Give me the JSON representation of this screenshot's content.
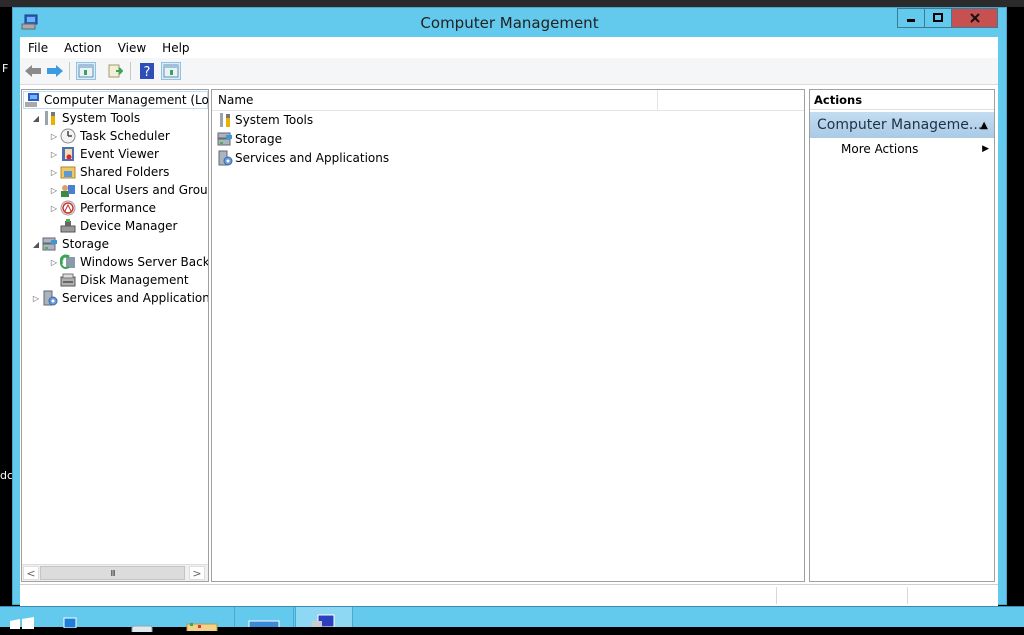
{
  "window": {
    "title": "Computer Management",
    "controls": {
      "minimize": "minimize",
      "maximize": "maximize",
      "close": "close"
    }
  },
  "menu": [
    "File",
    "Action",
    "View",
    "Help"
  ],
  "toolbar": {
    "buttons": [
      "back-arrow",
      "forward-arrow",
      "show-hide-console-tree",
      "export-list",
      "help",
      "show-hide-action-pane"
    ]
  },
  "tree": {
    "items": [
      {
        "label": "Computer Management (Local",
        "level": 0,
        "expander": "",
        "icon": "computer-management-icon",
        "selected": true
      },
      {
        "label": "System Tools",
        "level": 1,
        "expander": "expanded",
        "icon": "system-tools-icon"
      },
      {
        "label": "Task Scheduler",
        "level": 2,
        "expander": "collapsed",
        "icon": "task-scheduler-icon"
      },
      {
        "label": "Event Viewer",
        "level": 2,
        "expander": "collapsed",
        "icon": "event-viewer-icon"
      },
      {
        "label": "Shared Folders",
        "level": 2,
        "expander": "collapsed",
        "icon": "shared-folders-icon"
      },
      {
        "label": "Local Users and Groups",
        "level": 2,
        "expander": "collapsed",
        "icon": "local-users-icon"
      },
      {
        "label": "Performance",
        "level": 2,
        "expander": "collapsed",
        "icon": "performance-icon"
      },
      {
        "label": "Device Manager",
        "level": 2,
        "expander": "",
        "icon": "device-manager-icon"
      },
      {
        "label": "Storage",
        "level": 1,
        "expander": "expanded",
        "icon": "storage-icon"
      },
      {
        "label": "Windows Server Backup",
        "level": 2,
        "expander": "collapsed",
        "icon": "server-backup-icon"
      },
      {
        "label": "Disk Management",
        "level": 2,
        "expander": "",
        "icon": "disk-management-icon"
      },
      {
        "label": "Services and Applications",
        "level": 1,
        "expander": "collapsed",
        "icon": "services-icon"
      }
    ],
    "scrollbar": {
      "left": "<",
      "right": ">",
      "grip": "III"
    }
  },
  "list": {
    "columns": [
      "Name",
      ""
    ],
    "rows": [
      {
        "label": "System Tools",
        "icon": "system-tools-icon"
      },
      {
        "label": "Storage",
        "icon": "storage-icon"
      },
      {
        "label": "Services and Applications",
        "icon": "services-icon"
      }
    ]
  },
  "actions": {
    "header": "Actions",
    "section": "Computer Manageme...",
    "section_caret": "▲",
    "items": [
      {
        "label": "More Actions",
        "arrow": "▶"
      }
    ]
  },
  "desktop": {
    "left_text_1": "F",
    "left_text_2": "dc"
  }
}
